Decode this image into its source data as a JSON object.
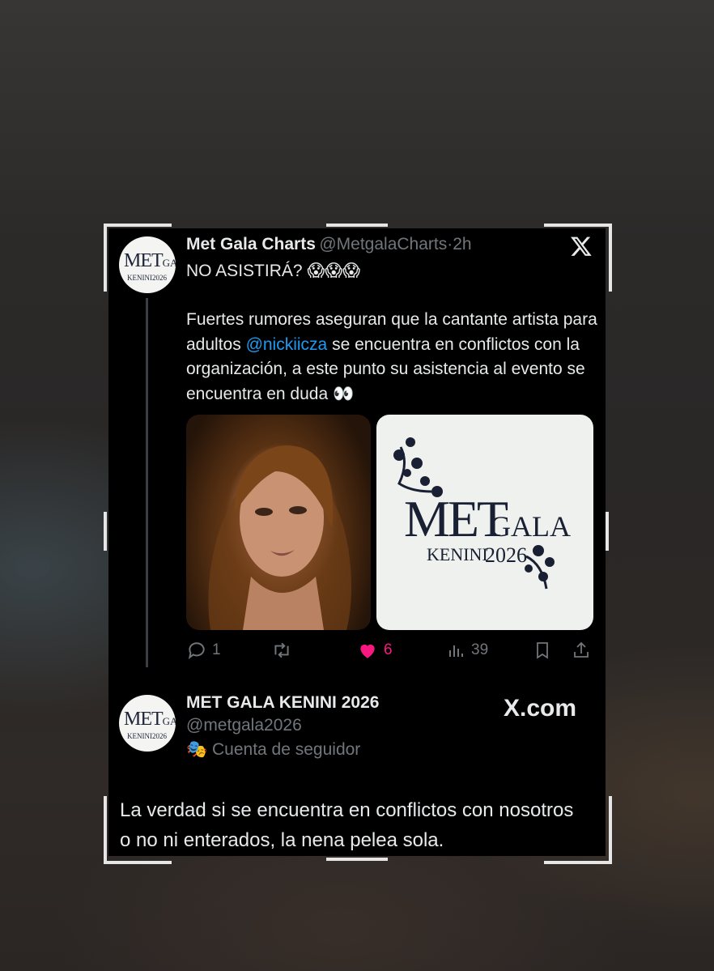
{
  "tweet": {
    "author_name": "Met Gala Charts",
    "handle": "@MetgalaCharts",
    "separator": "·",
    "time": "2h",
    "headline": "NO ASISTIRÁ?",
    "headline_emojis": "😱😱😱",
    "body_part1": "Fuertes rumores aseguran que la cantante artista para adultos ",
    "mention": "@nickiicza",
    "body_part2": " se encuentra en conflictos con la organización, a este punto su asistencia al evento se encuentra en duda ",
    "body_emoji": "👀",
    "media": [
      {
        "description": "woman-portrait-photo"
      },
      {
        "logo_line1": "MET",
        "logo_line2": "GALA",
        "logo_line3": "KENINI",
        "logo_line4": "2026"
      }
    ],
    "actions": {
      "replies": "1",
      "retweets": "",
      "likes": "6",
      "views": "39"
    }
  },
  "reply": {
    "author_name": "MET GALA KENINI 2026",
    "handle": "@metgala2026",
    "account_label": "Cuenta de seguidor",
    "account_emoji": "🎭",
    "watermark": "X.com"
  },
  "avatar_logo": {
    "l1": "MET",
    "l2": "GALA",
    "l3": "KENINI",
    "l4": "2026"
  },
  "caption": "La verdad si se encuentra en conflictos con nosotros o no ni enterados, la nena pelea sola.",
  "colors": {
    "mention": "#1d9bf0",
    "like": "#f91880",
    "muted": "#71767b",
    "card_bg": "#000000"
  }
}
